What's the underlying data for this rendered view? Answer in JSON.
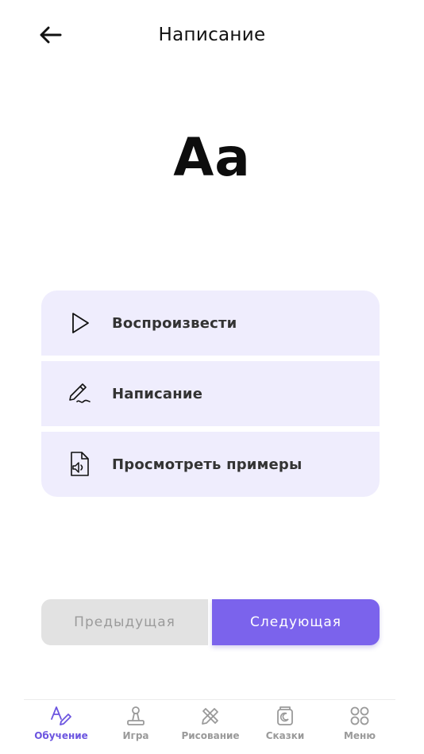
{
  "header": {
    "title": "Написание",
    "back_icon": "arrow-left-icon"
  },
  "lesson": {
    "letter": "Аа"
  },
  "actions": [
    {
      "label": "Воспроизвести",
      "icon": "play-icon"
    },
    {
      "label": "Написание",
      "icon": "pen-write-icon"
    },
    {
      "label": "Просмотреть примеры",
      "icon": "audio-file-icon"
    }
  ],
  "nav_buttons": {
    "prev": "Предыдущая",
    "next": "Следующая"
  },
  "tabbar": {
    "items": [
      {
        "label": "Обучение",
        "icon": "learning-icon",
        "active": true
      },
      {
        "label": "Игра",
        "icon": "game-icon",
        "active": false
      },
      {
        "label": "Рисование",
        "icon": "drawing-icon",
        "active": false
      },
      {
        "label": "Сказки",
        "icon": "tales-icon",
        "active": false
      },
      {
        "label": "Меню",
        "icon": "menu-grid-icon",
        "active": false
      }
    ]
  },
  "colors": {
    "accent": "#7b63ec",
    "card_bg": "#efedfd",
    "disabled_bg": "#e2e2e2",
    "disabled_text": "#9b9b9b",
    "tab_inactive": "#9a9a9a",
    "tab_active": "#6c55e0"
  }
}
